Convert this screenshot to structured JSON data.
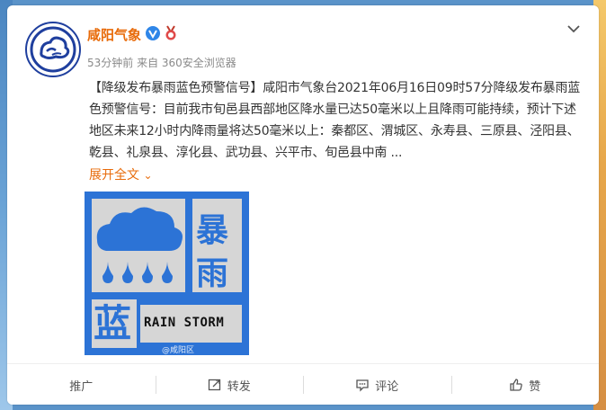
{
  "post": {
    "username": "咸阳气象",
    "meta": "53分钟前 来自 360安全浏览器",
    "text": "【降级发布暴雨蓝色预警信号】咸阳市气象台2021年06月16日09时57分降级发布暴雨蓝色预警信号：目前我市旬邑县西部地区降水量已达50毫米以上且降雨可能持续，预计下述地区未来12小时内降雨量将达50毫米以上：秦都区、渭城区、永寿县、三原县、泾阳县、乾县、礼泉县、淳化县、武功县、兴平市、旬邑县中南 ...",
    "expand_label": "展开全文",
    "expand_arrow": "⌄"
  },
  "warning_image": {
    "char_top": "暴",
    "char_mid": "雨",
    "char_bottom": "蓝",
    "english": "RAIN STORM",
    "watermark": "@咸阳区",
    "colors": {
      "background": "#2c73d6",
      "panel": "#d6d6d6",
      "text": "#2c73d6"
    }
  },
  "footer": {
    "promote": "推广",
    "repost": "转发",
    "comment": "评论",
    "like": "赞"
  },
  "icons": [
    "logo-icon",
    "verified-icon",
    "medal-icon",
    "chevron-down-icon",
    "repost-icon",
    "comment-icon",
    "like-icon"
  ],
  "colors": {
    "brand_orange": "#e86b0a",
    "meta_gray": "#8a8a8a"
  }
}
